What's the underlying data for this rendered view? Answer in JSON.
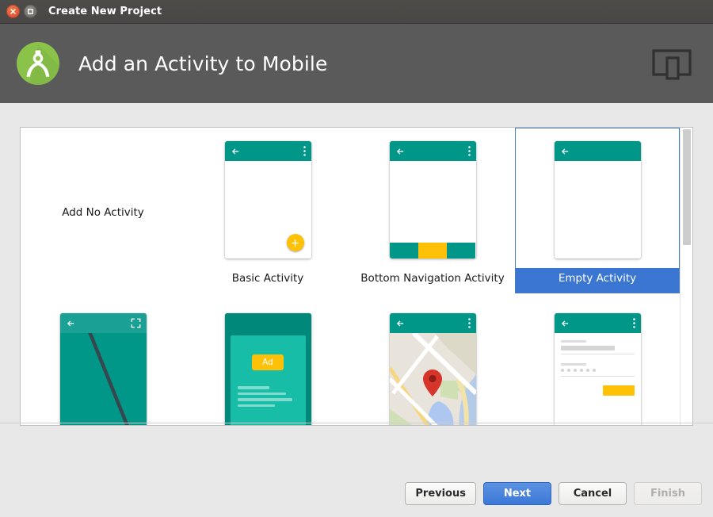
{
  "window": {
    "title": "Create New Project",
    "close_icon": "close-icon",
    "maximize_icon": "maximize-icon"
  },
  "header": {
    "title": "Add an Activity to Mobile",
    "logo_icon": "android-studio-logo-icon",
    "device_icon": "devices-icon"
  },
  "gallery": {
    "items": [
      {
        "label": "Add No Activity",
        "kind": "text-only",
        "selected": false
      },
      {
        "label": "Basic Activity",
        "kind": "basic",
        "selected": false
      },
      {
        "label": "Bottom Navigation Activity",
        "kind": "bottom-navigation",
        "selected": false
      },
      {
        "label": "Empty Activity",
        "kind": "empty",
        "selected": true
      },
      {
        "label": "",
        "kind": "fullscreen",
        "selected": false
      },
      {
        "label": "",
        "kind": "admob",
        "selected": false
      },
      {
        "label": "",
        "kind": "maps",
        "selected": false
      },
      {
        "label": "",
        "kind": "login",
        "selected": false
      }
    ],
    "ad_badge_label": "Ad"
  },
  "footer": {
    "previous_label": "Previous",
    "next_label": "Next",
    "cancel_label": "Cancel",
    "finish_label": "Finish"
  },
  "colors": {
    "titlebar": "#4b4946",
    "header_bg": "#5a5a5a",
    "body_bg": "#e8e8e8",
    "teal": "#009688",
    "amber": "#ffc107",
    "selection_blue": "#3b76d2",
    "primary_button": "#3c78d8"
  }
}
